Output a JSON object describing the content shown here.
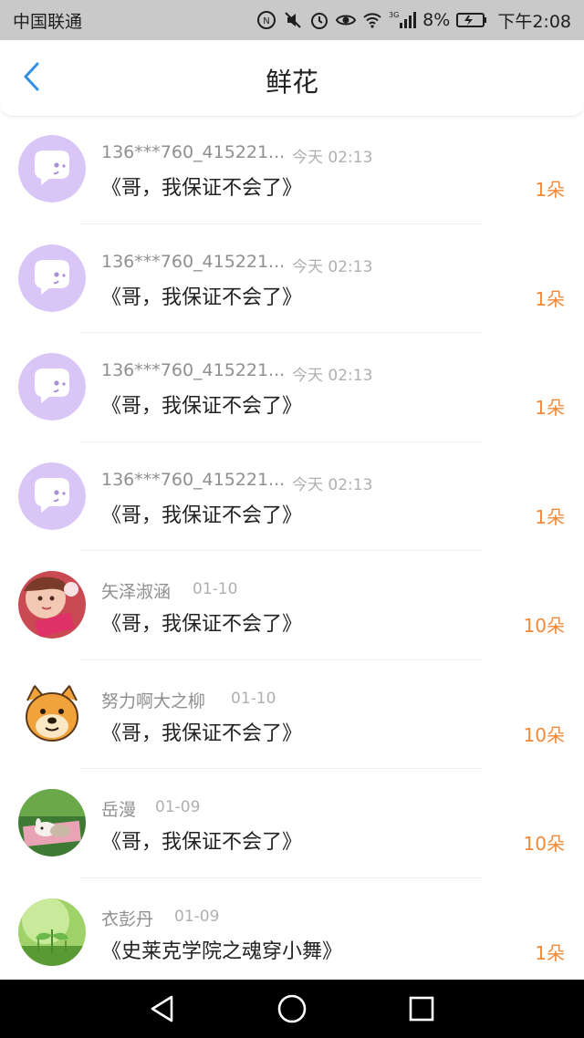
{
  "status_bar": {
    "carrier": "中国联通",
    "network": "3G",
    "battery": "8%",
    "time": "下午2:08",
    "icons": [
      "nfc-icon",
      "mute-icon",
      "alarm-icon",
      "eye-icon",
      "wifi-icon",
      "signal-icon",
      "battery-icon"
    ]
  },
  "nav": {
    "title": "鲜花",
    "back_icon": "chevron-left-icon"
  },
  "colors": {
    "accent": "#2f8ee8",
    "count": "#f08a3a",
    "default_avatar": "#d9c6f7"
  },
  "rows": [
    {
      "name": "136***760_415221...",
      "time": "今天 02:13",
      "gift": "《哥，我保证不会了》",
      "count": "1朵",
      "avatar": "default-chat-avatar"
    },
    {
      "name": "136***760_415221...",
      "time": "今天 02:13",
      "gift": "《哥，我保证不会了》",
      "count": "1朵",
      "avatar": "default-chat-avatar"
    },
    {
      "name": "136***760_415221...",
      "time": "今天 02:13",
      "gift": "《哥，我保证不会了》",
      "count": "1朵",
      "avatar": "default-chat-avatar"
    },
    {
      "name": "136***760_415221...",
      "time": "今天 02:13",
      "gift": "《哥，我保证不会了》",
      "count": "1朵",
      "avatar": "default-chat-avatar"
    },
    {
      "name": "矢泽淑涵",
      "time": "01-10",
      "gift": "《哥，我保证不会了》",
      "count": "10朵",
      "avatar": "user-photo-avatar"
    },
    {
      "name": "努力啊大之柳",
      "time": "01-10",
      "gift": "《哥，我保证不会了》",
      "count": "10朵",
      "avatar": "dog-cartoon-avatar"
    },
    {
      "name": "岳漫",
      "time": "01-09",
      "gift": "《哥，我保证不会了》",
      "count": "10朵",
      "avatar": "bunny-photo-avatar"
    },
    {
      "name": "衣彭丹",
      "time": "01-09",
      "gift": "《史莱克学院之魂穿小舞》",
      "count": "1朵",
      "avatar": "leaf-photo-avatar"
    }
  ],
  "system_nav": {
    "icons": [
      "back-triangle-icon",
      "home-circle-icon",
      "recents-square-icon"
    ]
  }
}
